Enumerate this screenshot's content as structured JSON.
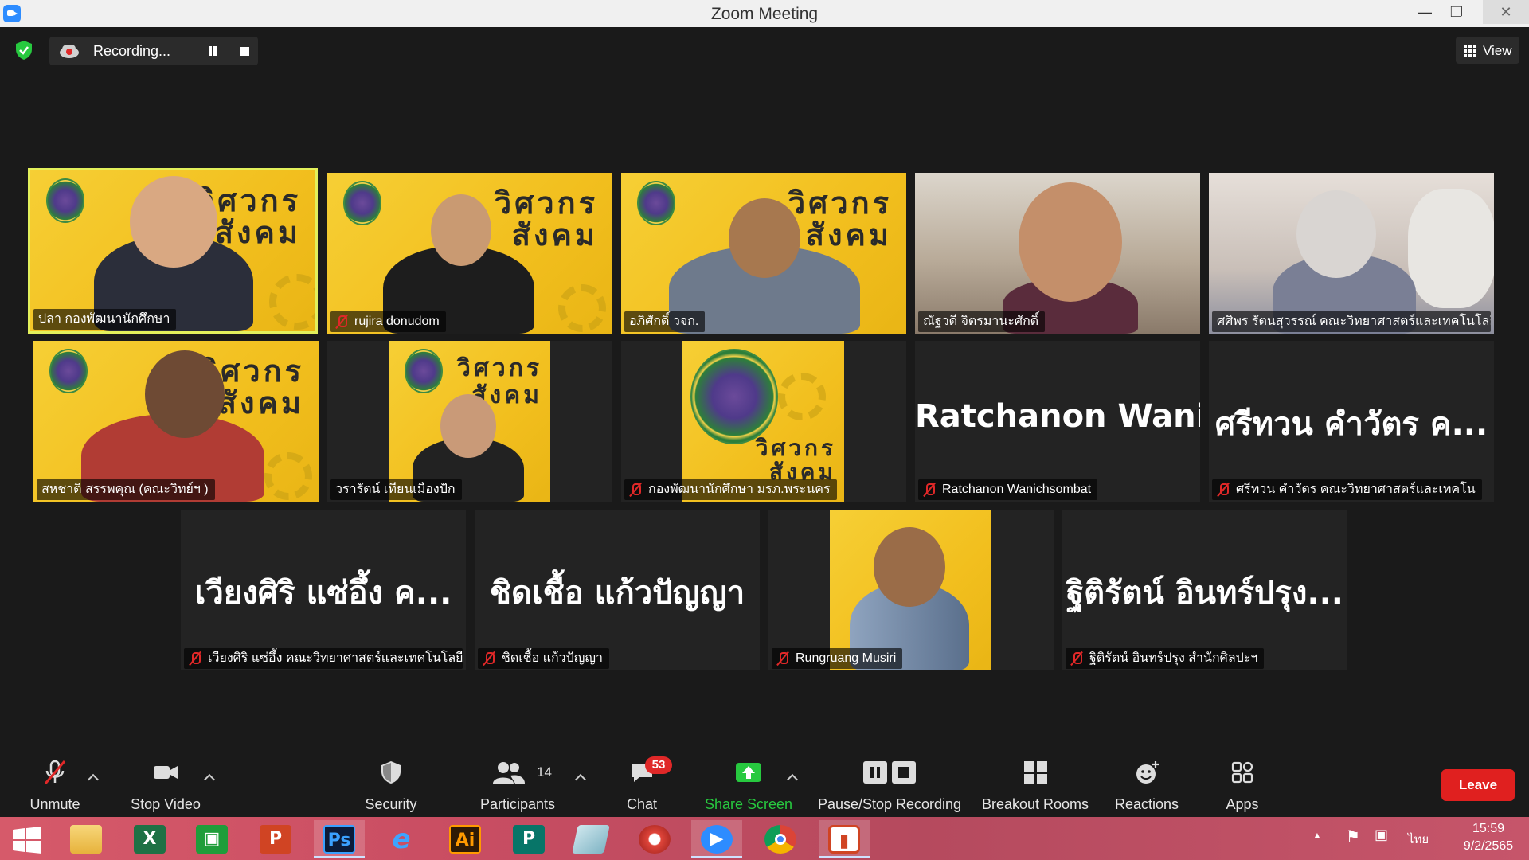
{
  "window": {
    "title": "Zoom Meeting",
    "min": "—",
    "max": "❐",
    "close": "✕"
  },
  "topbar": {
    "recording_label": "Recording...",
    "view_label": "View"
  },
  "tiles": [
    {
      "name": "ปลา กองพัฒนานักศึกษา",
      "muted": false,
      "banner": "วิศวกร\nสังคม"
    },
    {
      "name": "rujira donudom",
      "muted": true,
      "banner": "วิศวกร\nสังคม"
    },
    {
      "name": "อภิศักดิ์ วจก.",
      "muted": false,
      "banner": "วิศวกร\nสังคม"
    },
    {
      "name": "ณัฐวดี จิตรมานะศักดิ์",
      "muted": false
    },
    {
      "name": "ศศิพร รัตนสุวรรณ์ คณะวิทยาศาสตร์และเทคโนโลยี",
      "muted": false
    },
    {
      "name": "สหชาติ สรรพคุณ (คณะวิทย์ฯ )",
      "muted": false,
      "banner": "วิศวกร\nสังคม"
    },
    {
      "name": "วรารัตน์ เทียนเมืองปัก",
      "muted": false,
      "banner": "วิศวกร\nสังคม"
    },
    {
      "name": "กองพัฒนานักศึกษา มรภ.พระนคร",
      "muted": true,
      "banner": "วิศวกร\nสังคม"
    },
    {
      "name": "Ratchanon Wanichsombat",
      "big": "Ratchanon Wani...",
      "muted": true
    },
    {
      "name": "ศรีทวน คำวัตร คณะวิทยาศาสตร์และเทคโน",
      "big": "ศรีทวน คำวัตร ค...",
      "muted": true
    },
    {
      "name": "เวียงศิริ แซ่อึ้ง คณะวิทยาศาสตร์และเทคโนโลยี",
      "big": "เวียงศิริ แซ่อึ้ง ค...",
      "muted": true
    },
    {
      "name": "ชิดเชื้อ แก้วปัญญา",
      "big": "ชิดเชื้อ แก้วปัญญา",
      "muted": true
    },
    {
      "name": "Rungruang Musiri",
      "muted": true
    },
    {
      "name": "ฐิติรัตน์ อินทร์ปรุง สำนักศิลปะฯ",
      "big": "ฐิติรัตน์ อินทร์ปรุง...",
      "muted": true
    }
  ],
  "toolbar": {
    "unmute": "Unmute",
    "stop_video": "Stop Video",
    "security": "Security",
    "participants": "Participants",
    "participants_count": "14",
    "chat": "Chat",
    "chat_badge": "53",
    "share_screen": "Share Screen",
    "pause_stop_recording": "Pause/Stop Recording",
    "breakout_rooms": "Breakout Rooms",
    "reactions": "Reactions",
    "apps": "Apps",
    "leave": "Leave"
  },
  "taskbar": {
    "apps": [
      "windows-start",
      "file-explorer",
      "excel",
      "publisher-green",
      "powerpoint",
      "photoshop",
      "internet-explorer",
      "illustrator",
      "publisher",
      "notes",
      "photoscape",
      "zoom",
      "chrome",
      "slides"
    ],
    "labels": {
      "excel": "X",
      "powerpoint": "P",
      "photoshop": "Ps",
      "illustrator": "Ai",
      "publisher": "P"
    },
    "language": "ไทย",
    "time": "15:59",
    "date": "9/2/2565"
  },
  "colors": {
    "accent_green": "#27c93f",
    "leave_red": "#e0201f",
    "active_speaker": "#e3f05b",
    "zoom_blue": "#2d8cff"
  }
}
